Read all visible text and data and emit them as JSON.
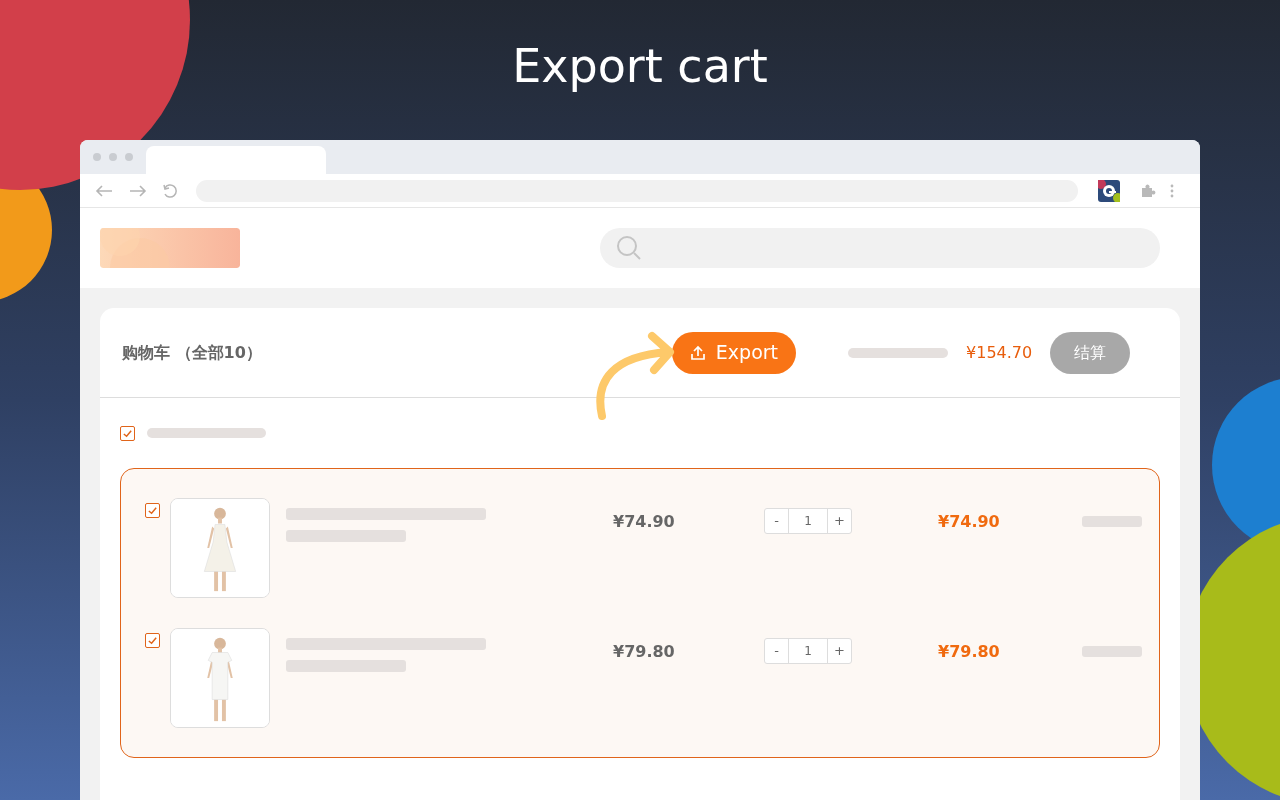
{
  "heading": "Export cart",
  "cart": {
    "title": "购物车 （全部10）",
    "export_button": "Export",
    "total": "¥154.70",
    "checkout_button": "结算",
    "select_all": {
      "checked": true
    },
    "items": [
      {
        "checked": true,
        "price": "¥74.90",
        "quantity": "1",
        "minus": "-",
        "plus": "+",
        "subtotal": "¥74.90"
      },
      {
        "checked": true,
        "price": "¥79.80",
        "quantity": "1",
        "minus": "-",
        "plus": "+",
        "subtotal": "¥79.80"
      }
    ]
  }
}
